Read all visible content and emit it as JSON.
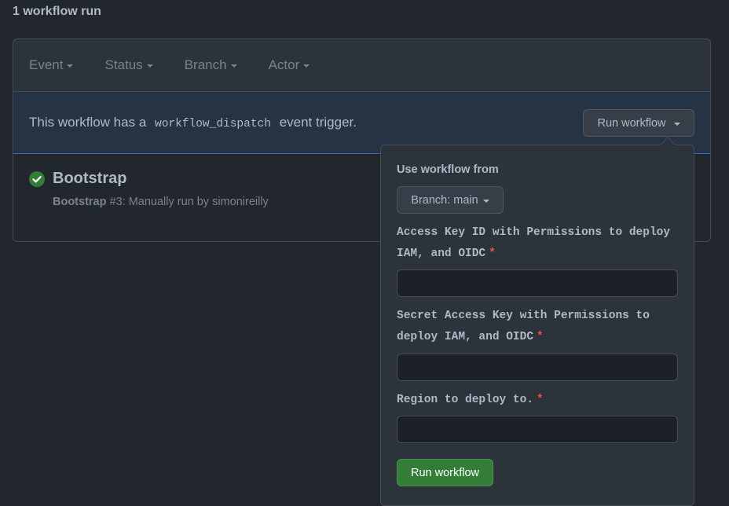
{
  "page": {
    "runs_count": "1 workflow run"
  },
  "filters": {
    "items": [
      {
        "label": "Event"
      },
      {
        "label": "Status"
      },
      {
        "label": "Branch"
      },
      {
        "label": "Actor"
      }
    ]
  },
  "dispatch": {
    "text_before": "This workflow has a",
    "event_name": "workflow_dispatch",
    "text_after": "event trigger.",
    "run_button_label": "Run workflow"
  },
  "run": {
    "title": "Bootstrap",
    "workflow_name": "Bootstrap",
    "meta": "#3: Manually run by simonireilly",
    "status_icon": "check-circle-fill",
    "status_color": "#347d39"
  },
  "popover": {
    "heading": "Use workflow from",
    "branch_label": "Branch: main",
    "fields": [
      {
        "label": "Access Key ID with Permissions to deploy IAM, and OIDC",
        "required_mark": "*",
        "value": ""
      },
      {
        "label": "Secret Access Key with Permissions to deploy IAM, and OIDC",
        "required_mark": "*",
        "value": ""
      },
      {
        "label": "Region to deploy to.",
        "required_mark": "*",
        "value": ""
      }
    ],
    "submit_label": "Run workflow"
  },
  "colors": {
    "background": "#22272e",
    "banner": "#263345",
    "accent_green": "#347d39",
    "required_red": "#e5534b"
  }
}
